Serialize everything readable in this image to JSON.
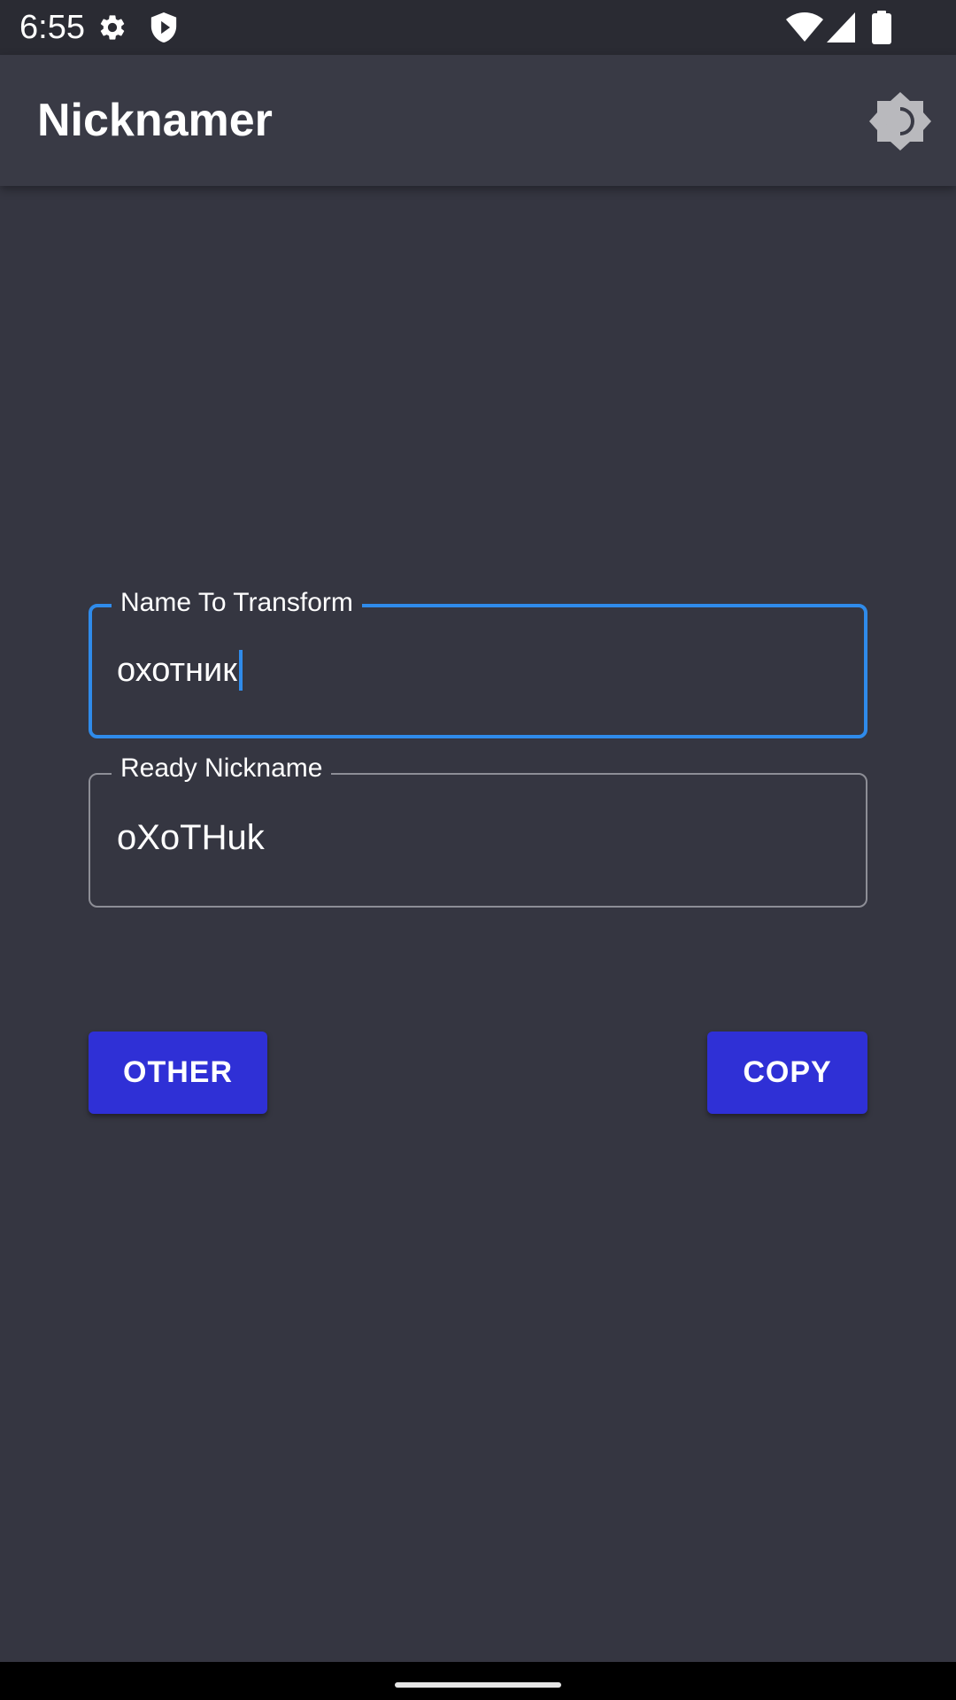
{
  "status_bar": {
    "time": "6:55",
    "icons": [
      "gear-icon",
      "shield-icon",
      "wifi-icon",
      "signal-icon",
      "battery-icon"
    ]
  },
  "app_bar": {
    "title": "Nicknamer",
    "theme_toggle_icon": "brightness-icon"
  },
  "form": {
    "name_field": {
      "label": "Name To Transform",
      "value": "охотник",
      "focused": true
    },
    "nickname_field": {
      "label": "Ready Nickname",
      "value": "oXoTHuk"
    }
  },
  "actions": {
    "other_label": "OTHER",
    "copy_label": "COPY"
  },
  "colors": {
    "background": "#353641",
    "app_bar": "#393a45",
    "status_bar": "#2a2b33",
    "accent": "#2f8bea",
    "button": "#2f30d6"
  }
}
